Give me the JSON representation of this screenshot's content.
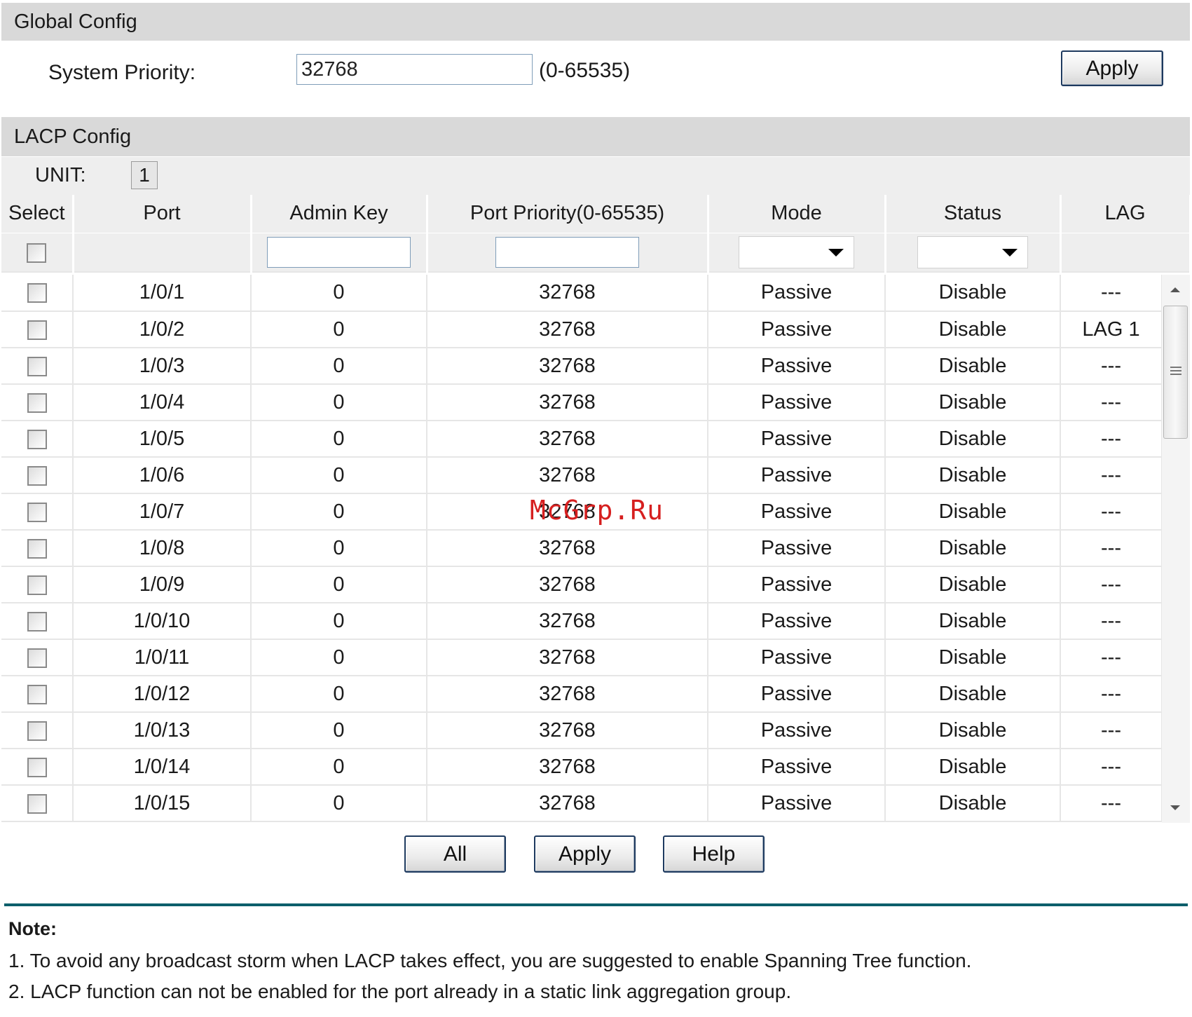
{
  "global_config": {
    "title": "Global Config",
    "system_priority_label": "System Priority:",
    "system_priority_value": "32768",
    "system_priority_range": "(0-65535)",
    "apply_label": "Apply"
  },
  "lacp_config": {
    "title": "LACP Config",
    "unit_label": "UNIT:",
    "unit_value": "1",
    "columns": [
      "Select",
      "Port",
      "Admin Key",
      "Port Priority(0-65535)",
      "Mode",
      "Status",
      "LAG"
    ],
    "rows": [
      {
        "port": "1/0/1",
        "admin_key": "0",
        "priority": "32768",
        "mode": "Passive",
        "status": "Disable",
        "lag": "---"
      },
      {
        "port": "1/0/2",
        "admin_key": "0",
        "priority": "32768",
        "mode": "Passive",
        "status": "Disable",
        "lag": "LAG 1"
      },
      {
        "port": "1/0/3",
        "admin_key": "0",
        "priority": "32768",
        "mode": "Passive",
        "status": "Disable",
        "lag": "---"
      },
      {
        "port": "1/0/4",
        "admin_key": "0",
        "priority": "32768",
        "mode": "Passive",
        "status": "Disable",
        "lag": "---"
      },
      {
        "port": "1/0/5",
        "admin_key": "0",
        "priority": "32768",
        "mode": "Passive",
        "status": "Disable",
        "lag": "---"
      },
      {
        "port": "1/0/6",
        "admin_key": "0",
        "priority": "32768",
        "mode": "Passive",
        "status": "Disable",
        "lag": "---"
      },
      {
        "port": "1/0/7",
        "admin_key": "0",
        "priority": "32768",
        "mode": "Passive",
        "status": "Disable",
        "lag": "---"
      },
      {
        "port": "1/0/8",
        "admin_key": "0",
        "priority": "32768",
        "mode": "Passive",
        "status": "Disable",
        "lag": "---"
      },
      {
        "port": "1/0/9",
        "admin_key": "0",
        "priority": "32768",
        "mode": "Passive",
        "status": "Disable",
        "lag": "---"
      },
      {
        "port": "1/0/10",
        "admin_key": "0",
        "priority": "32768",
        "mode": "Passive",
        "status": "Disable",
        "lag": "---"
      },
      {
        "port": "1/0/11",
        "admin_key": "0",
        "priority": "32768",
        "mode": "Passive",
        "status": "Disable",
        "lag": "---"
      },
      {
        "port": "1/0/12",
        "admin_key": "0",
        "priority": "32768",
        "mode": "Passive",
        "status": "Disable",
        "lag": "---"
      },
      {
        "port": "1/0/13",
        "admin_key": "0",
        "priority": "32768",
        "mode": "Passive",
        "status": "Disable",
        "lag": "---"
      },
      {
        "port": "1/0/14",
        "admin_key": "0",
        "priority": "32768",
        "mode": "Passive",
        "status": "Disable",
        "lag": "---"
      },
      {
        "port": "1/0/15",
        "admin_key": "0",
        "priority": "32768",
        "mode": "Passive",
        "status": "Disable",
        "lag": "---"
      }
    ],
    "buttons": {
      "all": "All",
      "apply": "Apply",
      "help": "Help"
    }
  },
  "watermark": "McGrp.Ru",
  "note": {
    "title": "Note:",
    "lines": [
      "1. To avoid any broadcast storm when LACP takes effect, you are suggested to enable Spanning Tree function.",
      "2. LACP function can not be enabled for the port already in a static link aggregation group."
    ]
  },
  "icons": {
    "dropdown": "chevron-down-icon",
    "scroll_up": "arrow-up-icon",
    "scroll_down": "arrow-down-icon"
  }
}
